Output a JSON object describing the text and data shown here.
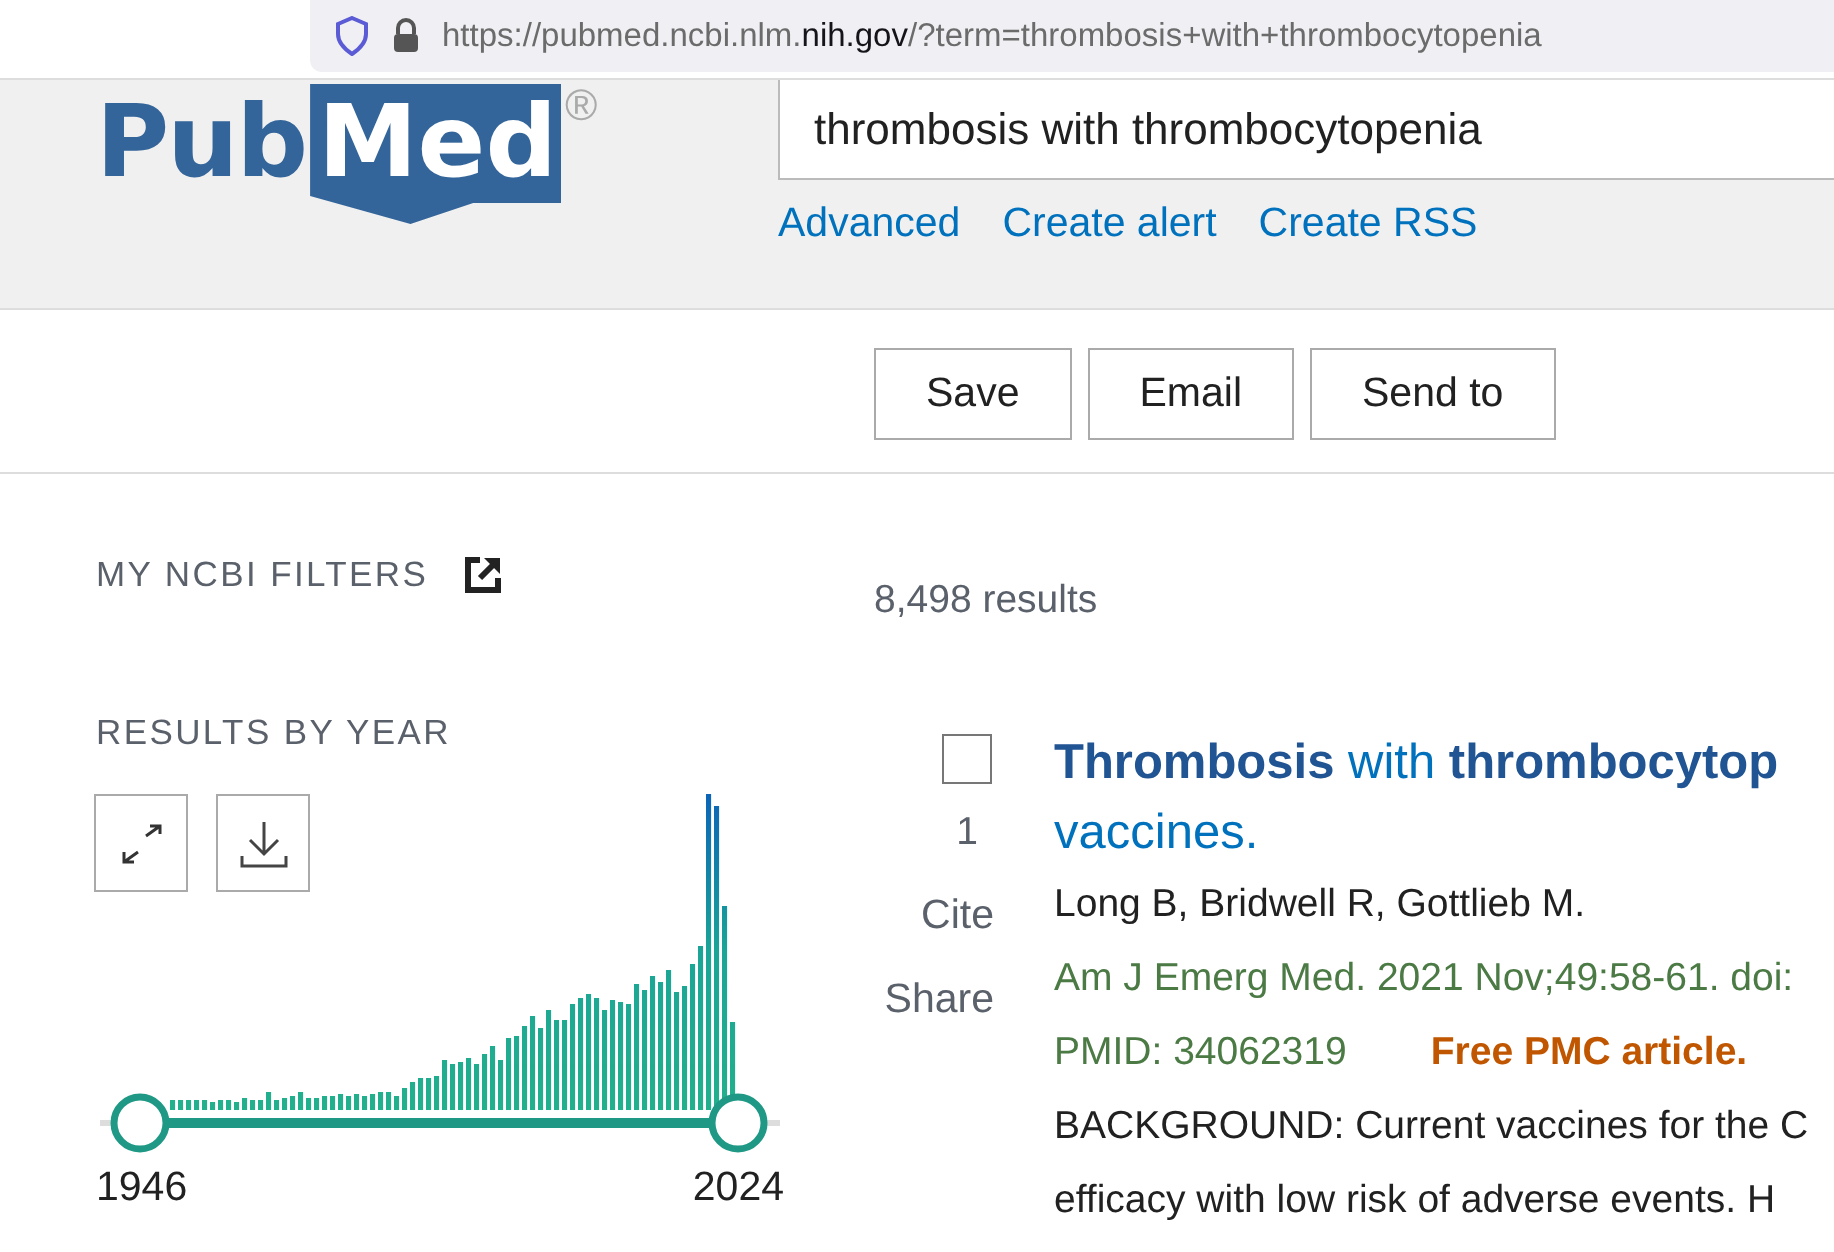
{
  "address_bar": {
    "url_start": "https://pubmed.ncbi.nlm.",
    "url_domain": "nih.gov",
    "url_end": "/?term=thrombosis+with+thrombocytopenia"
  },
  "logo": {
    "part_1": "Pub",
    "part_2": "Med",
    "mark": "®"
  },
  "search": {
    "value": "thrombosis with thrombocytopenia"
  },
  "search_links": [
    "Advanced",
    "Create alert",
    "Create RSS"
  ],
  "actions": [
    "Save",
    "Email",
    "Send to"
  ],
  "sidebar": {
    "filters_title": "MY NCBI FILTERS",
    "timeline_title": "RESULTS BY YEAR",
    "start_year": "1946",
    "end_year": "2024",
    "range_handles": [
      {
        "level": 0
      },
      {
        "level": 1
      }
    ]
  },
  "results": {
    "count": "8,498 results",
    "items": [
      {
        "selected": false,
        "number": "1",
        "actions": [
          "Cite",
          "Share"
        ],
        "title_lines": [
          "**Thrombosis** with **thrombocytop**",
          "vaccines."
        ],
        "authors": "Long B, Bridwell R, Gottlieb M.",
        "citation": "Am J Emerg Med. 2021 Nov;49:58-61. doi:",
        "pmid": "PMID: 34062319",
        "free_article": "Free PMC article.",
        "snippet_lines": [
          "BACKGROUND: Current vaccines for the C",
          "efficacy with low risk of adverse events. H"
        ]
      }
    ]
  }
}
